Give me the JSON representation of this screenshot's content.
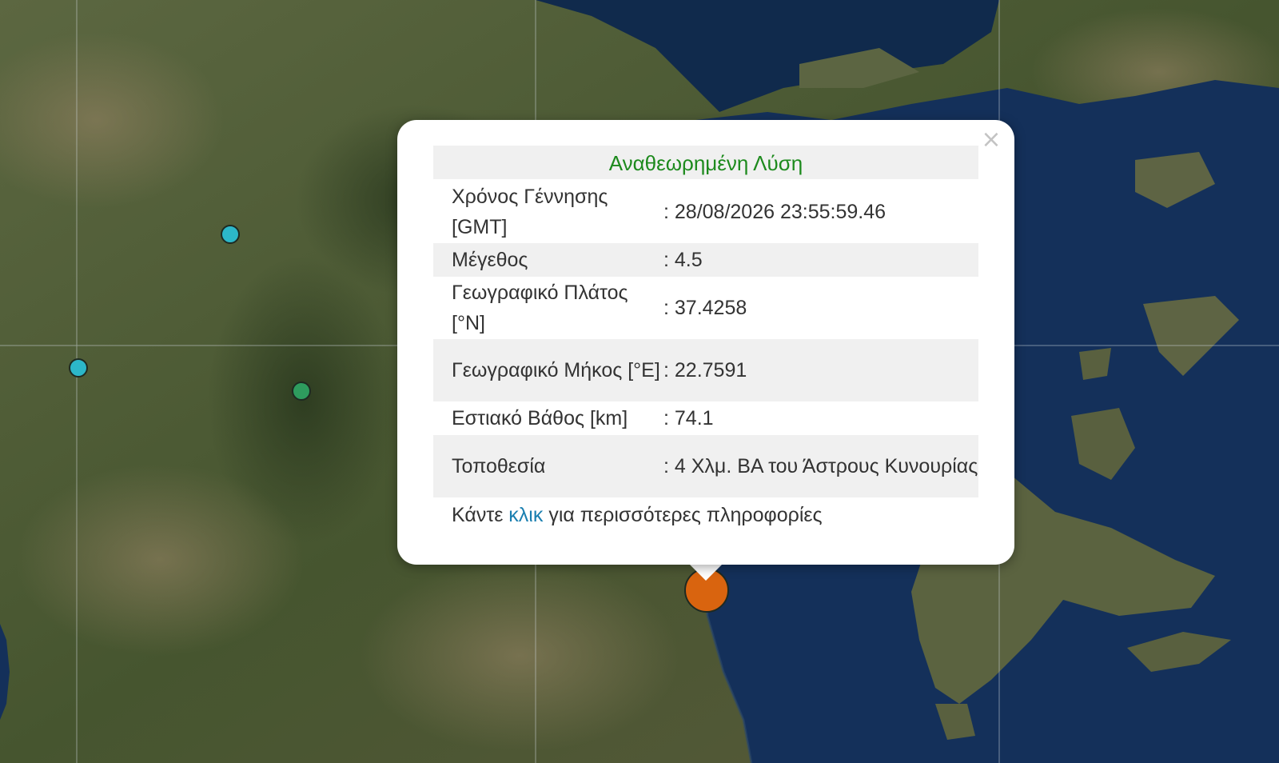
{
  "map": {
    "land_color": "#4d5a36",
    "sea_color": "#102a4c",
    "gridline_color": "#cfd6dc"
  },
  "markers": [
    {
      "name": "event-marker-1",
      "color": "#2cb7c9"
    },
    {
      "name": "event-marker-2",
      "color": "#2cb7c9"
    },
    {
      "name": "event-marker-3",
      "color": "#2e9c5e"
    },
    {
      "name": "selected-event-marker",
      "color": "#d9640f"
    }
  ],
  "popup": {
    "close_label": "×",
    "title": "Αναθεωρημένη Λύση",
    "rows": [
      {
        "key": "Χρόνος Γέννησης [GMT]",
        "value": ": 28/08/2026 23:55:59.46"
      },
      {
        "key": "Μέγεθος",
        "value": ": 4.5"
      },
      {
        "key": "Γεωγραφικό Πλάτος [°N]",
        "value": ": 37.4258"
      },
      {
        "key": "Γεωγραφικό Μήκος [°E]",
        "value": ": 22.7591"
      },
      {
        "key": "Εστιακό Βάθος [km]",
        "value": ": 74.1"
      },
      {
        "key": "Τοποθεσία",
        "value": ": 4 Χλμ. ΒΑ του Άστρους Κυνουρίας"
      }
    ],
    "footer_prefix": "Κάντε",
    "footer_link": "κλικ",
    "footer_suffix": "για περισσότερες πληροφορίες"
  }
}
